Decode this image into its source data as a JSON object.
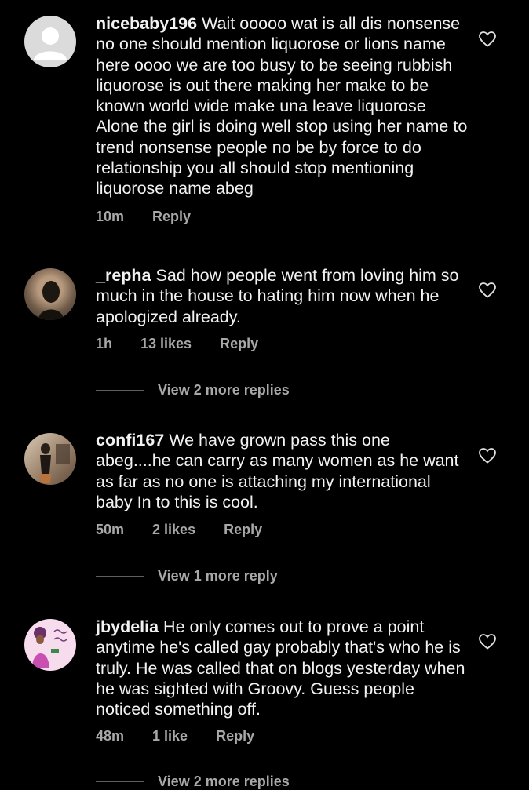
{
  "comments": [
    {
      "username": "nicebaby196",
      "text": "Wait ooooo wat is all dis nonsense no one should mention liquorose or lions name here oooo we are too busy to be seeing rubbish liquorose is out there making her make to be known world wide make una leave liquorose Alone the girl is doing well stop using her name to trend nonsense people no be by force to do relationship you all should stop mentioning liquorose name abeg",
      "time": "10m",
      "likes": "",
      "reply": "Reply"
    },
    {
      "username": "_repha",
      "text": "Sad how people went from loving him so much in the house to hating him now when he apologized already.",
      "time": "1h",
      "likes": "13 likes",
      "reply": "Reply",
      "view_replies": "View 2 more replies"
    },
    {
      "username": "confi167",
      "text": "We have grown pass this one abeg....he can carry as many women as he want as far as no one is attaching my international baby In to this is cool.",
      "time": "50m",
      "likes": "2 likes",
      "reply": "Reply",
      "view_replies": "View 1 more reply"
    },
    {
      "username": "jbydelia",
      "text": "He only comes out to prove a point anytime he's called gay probably that's who he is truly. He was called that on blogs yesterday when he was sighted with Groovy. Guess people noticed something off.",
      "time": "48m",
      "likes": "1 like",
      "reply": "Reply",
      "view_replies": "View 2 more replies"
    }
  ]
}
